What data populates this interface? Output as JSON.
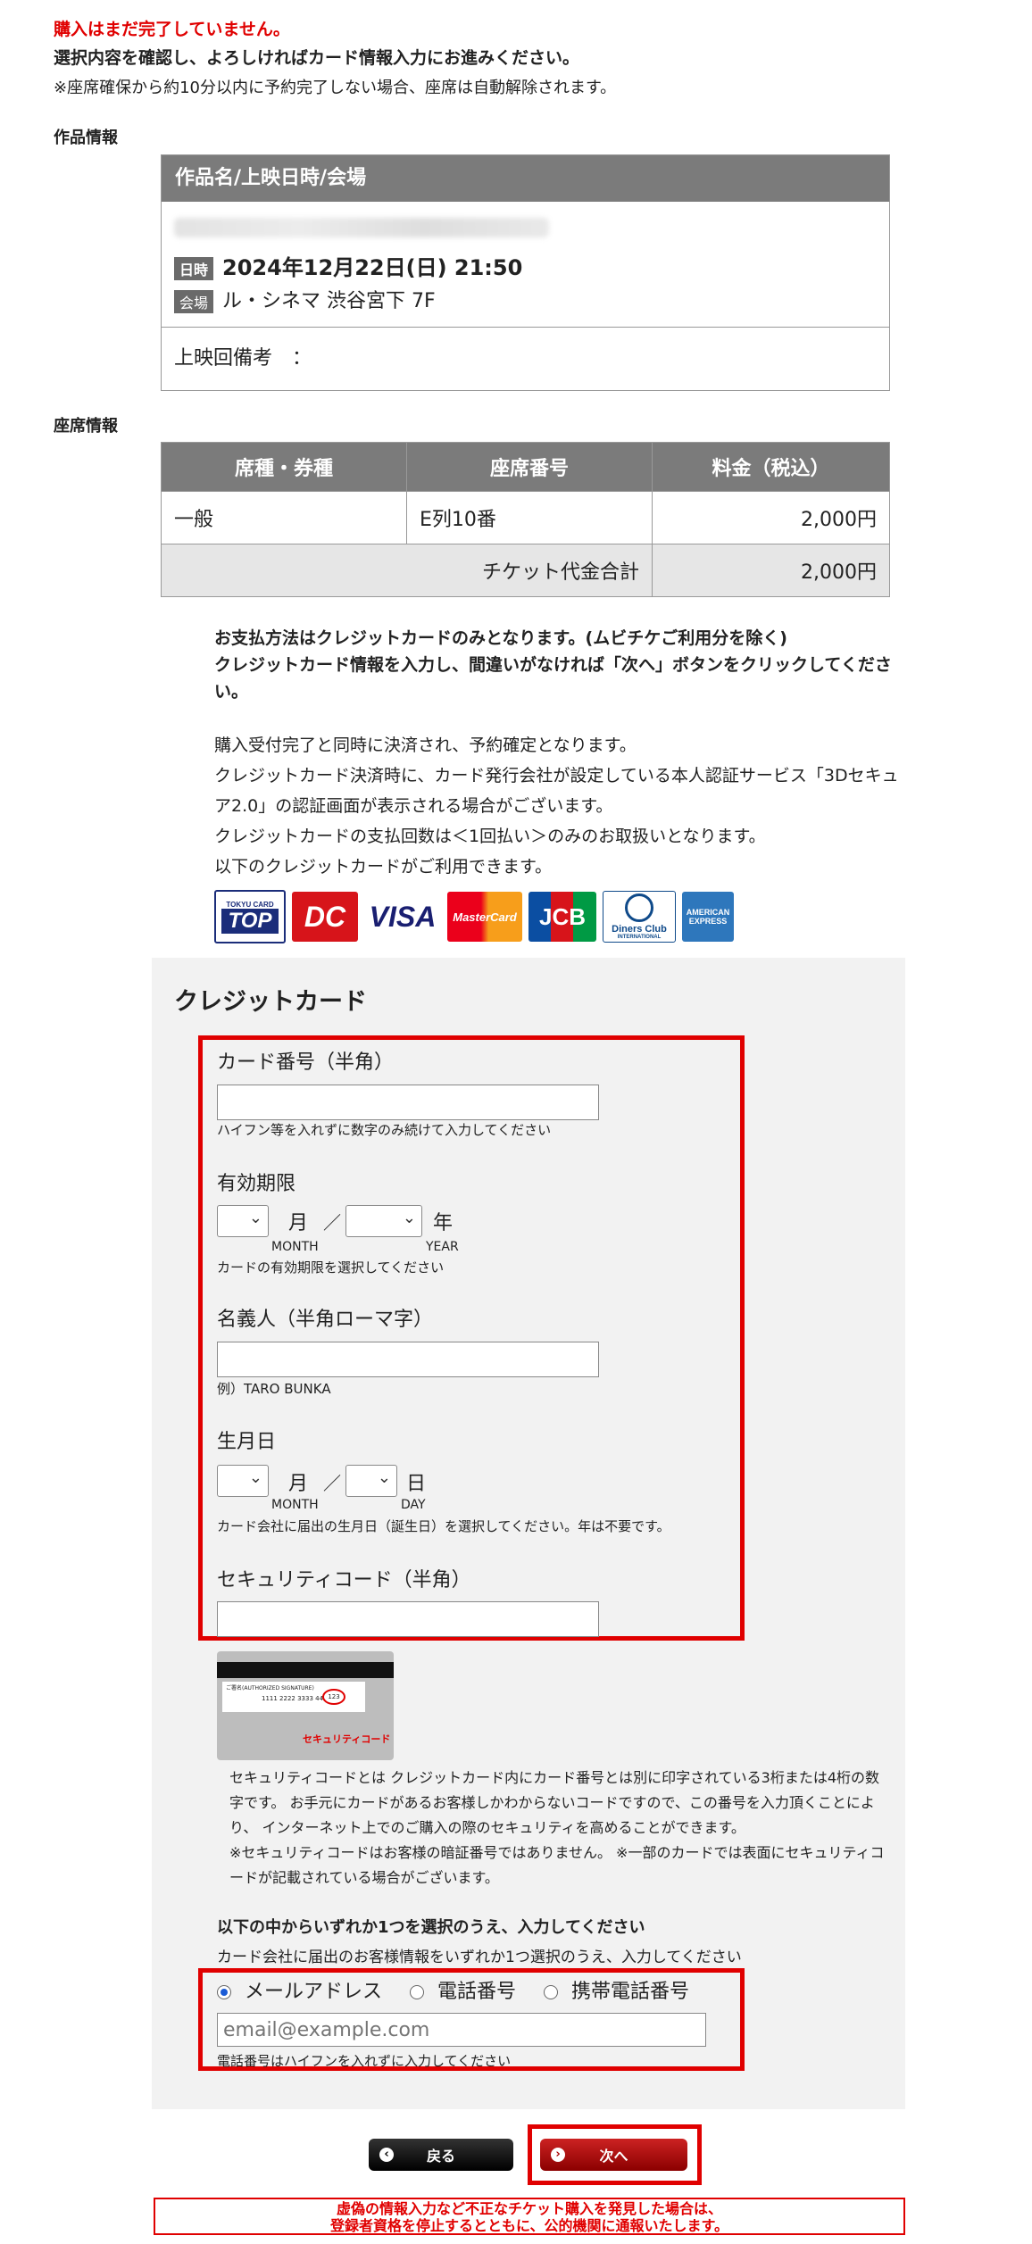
{
  "notices": {
    "incomplete": "購入はまだ完了していません。",
    "confirm": "選択内容を確認し、よろしければカード情報入力にお進みください。",
    "release": "※座席確保から約10分以内に予約完了しない場合、座席は自動解除されます。"
  },
  "work_info": {
    "section_label": "作品情報",
    "header": "作品名/上映日時/会場",
    "date_tag": "日時",
    "date": "2024年12月22日(日) 21:50",
    "venue_tag": "会場",
    "venue": "ル・シネマ 渋谷宮下 7F",
    "note_label": "上映回備考　："
  },
  "seat_info": {
    "section_label": "座席情報",
    "headers": [
      "席種・券種",
      "座席番号",
      "料金（税込）"
    ],
    "rows": [
      {
        "type": "一般",
        "seat": "E列10番",
        "price": "2,000円"
      }
    ],
    "total_label": "チケット代金合計",
    "total": "2,000円"
  },
  "payment": {
    "bold_line1": "お支払方法はクレジットカードのみとなります。(ムビチケご利用分を除く)",
    "bold_line2": "クレジットカード情報を入力し、間違いがなければ「次へ」ボタンをクリックしてください。",
    "line1": "購入受付完了と同時に決済され、予約確定となります。",
    "line2": "クレジットカード決済時に、カード発行会社が設定している本人認証サービス「3Dセキュア2.0」の認証画面が表示される場合がございます。",
    "line3": "クレジットカードの支払回数は＜1回払い＞のみのお取扱いとなります。",
    "line4": "以下のクレジットカードがご利用できます。"
  },
  "card_logos": {
    "tokyu_small": "TOKYU CARD",
    "tokyu": "TOP",
    "dc": "DC",
    "visa": "VISA",
    "master": "MasterCard",
    "jcb": "JCB",
    "diners": "Diners Club",
    "diners_small": "INTERNATIONAL",
    "amex": "AMERICAN EXPRESS"
  },
  "credit_form": {
    "title": "クレジットカード",
    "card_number_label": "カード番号（半角）",
    "card_number_hint": "ハイフン等を入れずに数字のみ続けて入力してください",
    "expiry_label": "有効期限",
    "month_unit": "月",
    "slash": "／",
    "year_unit": "年",
    "month_sub": "MONTH",
    "year_sub": "YEAR",
    "expiry_hint": "カードの有効期限を選択してください",
    "name_label": "名義人（半角ローマ字）",
    "name_hint": "例）TARO BUNKA",
    "birth_label": "生月日",
    "day_unit": "日",
    "day_sub": "DAY",
    "birth_hint": "カード会社に届出の生月日（誕生日）を選択してください。年は不要です。",
    "security_label": "セキュリティコード（半角）",
    "security_img_sig": "ご署名(AUTHORIZED SIGNATURE)",
    "security_img_num": "1111 2222 3333 4444",
    "security_img_code": "123",
    "security_img_caption": "セキュリティコード",
    "security_desc1": "セキュリティコードとは クレジットカード内にカード番号とは別に印字されている3桁または4桁の数字です。 お手元にカードがあるお客様しかわからないコードですので、この番号を入力頂くことにより、 インターネット上でのご購入の際のセキュリティを高めることができます。",
    "security_desc2": "※セキュリティコードはお客様の暗証番号ではありません。 ※一部のカードでは表面にセキュリティコードが記載されている場合がございます。",
    "contact_title": "以下の中からいずれか1つを選択のうえ、入力してください",
    "contact_sub": "カード会社に届出のお客様情報をいずれか1つ選択のうえ、入力してください",
    "opt_email": "メールアドレス",
    "opt_phone": "電話番号",
    "opt_mobile": "携帯電話番号",
    "email_placeholder": "email@example.com",
    "contact_hint": "電話番号はハイフンを入れずに入力してください"
  },
  "buttons": {
    "back": "戻る",
    "next": "次へ"
  },
  "warning": {
    "line1": "虚偽の情報入力など不正なチケット購入を発見した場合は、",
    "line2": "登録者資格を停止するとともに、公的機関に通報いたします。"
  },
  "colors": {
    "alert_red": "#e00000",
    "header_gray": "#7b7b7b",
    "form_bg": "#f2f2f2"
  }
}
